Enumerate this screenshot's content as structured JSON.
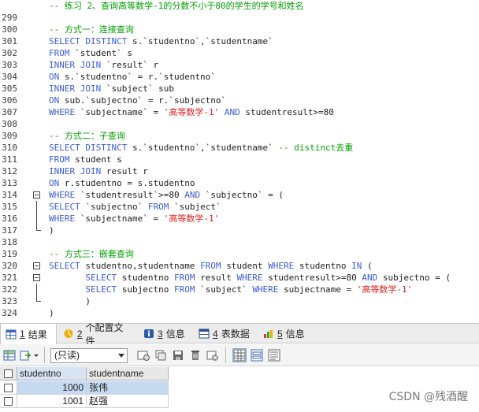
{
  "editor": {
    "lines": [
      {
        "n": "",
        "top": -1,
        "fold": "",
        "parts": [
          [
            "cm",
            "-- 练习 2、查询高等数学-1的分数不小于80的学生的学号和姓名"
          ]
        ]
      },
      {
        "n": "299",
        "fold": "",
        "parts": []
      },
      {
        "n": "300",
        "fold": "",
        "parts": [
          [
            "cm",
            "-- 方式一：连接查询"
          ]
        ]
      },
      {
        "n": "301",
        "fold": "",
        "parts": [
          [
            "kw",
            "SELECT DISTINCT "
          ],
          [
            "tx",
            "s.`studentno`,`studentname`"
          ]
        ]
      },
      {
        "n": "302",
        "fold": "",
        "parts": [
          [
            "kw",
            "FROM "
          ],
          [
            "tx",
            "`student` s"
          ]
        ]
      },
      {
        "n": "303",
        "fold": "",
        "parts": [
          [
            "kw",
            "INNER JOIN "
          ],
          [
            "tx",
            "`result` r"
          ]
        ]
      },
      {
        "n": "304",
        "fold": "",
        "parts": [
          [
            "kw",
            "ON "
          ],
          [
            "tx",
            "s.`studentno` = r.`studentno`"
          ]
        ]
      },
      {
        "n": "305",
        "fold": "",
        "parts": [
          [
            "kw",
            "INNER JOIN "
          ],
          [
            "tx",
            "`subject` sub"
          ]
        ]
      },
      {
        "n": "306",
        "fold": "",
        "parts": [
          [
            "kw",
            "ON "
          ],
          [
            "tx",
            "sub.`subjectno` = r.`subjectno`"
          ]
        ]
      },
      {
        "n": "307",
        "fold": "",
        "parts": [
          [
            "kw",
            "WHERE "
          ],
          [
            "tx",
            "`subjectname` = "
          ],
          [
            "str",
            "'高等数学-1'"
          ],
          [
            "kw",
            " AND "
          ],
          [
            "tx",
            "studentresult>=80"
          ]
        ]
      },
      {
        "n": "308",
        "fold": "",
        "parts": []
      },
      {
        "n": "309",
        "fold": "",
        "parts": [
          [
            "cm",
            "-- 方式二：子查询"
          ]
        ]
      },
      {
        "n": "310",
        "fold": "",
        "parts": [
          [
            "kw",
            "SELECT DISTINCT "
          ],
          [
            "tx",
            "s.`studentno`,`studentname` "
          ],
          [
            "cm",
            "-- distinct去重"
          ]
        ]
      },
      {
        "n": "311",
        "fold": "",
        "parts": [
          [
            "kw",
            "FROM "
          ],
          [
            "tx",
            "student s"
          ]
        ]
      },
      {
        "n": "312",
        "fold": "",
        "parts": [
          [
            "kw",
            "INNER JOIN "
          ],
          [
            "tx",
            "result r"
          ]
        ]
      },
      {
        "n": "313",
        "fold": "",
        "parts": [
          [
            "kw",
            "ON "
          ],
          [
            "tx",
            "r.studentno = s.studentno"
          ]
        ]
      },
      {
        "n": "314",
        "fold": "box",
        "parts": [
          [
            "kw",
            "WHERE "
          ],
          [
            "tx",
            "`studentresult`>=80 "
          ],
          [
            "kw",
            "AND "
          ],
          [
            "tx",
            "`subjectno` = ("
          ]
        ]
      },
      {
        "n": "315",
        "fold": "line",
        "parts": [
          [
            "kw",
            "SELECT "
          ],
          [
            "tx",
            "`subjectno` "
          ],
          [
            "kw",
            "FROM "
          ],
          [
            "tx",
            "`subject`"
          ]
        ]
      },
      {
        "n": "316",
        "fold": "line",
        "parts": [
          [
            "kw",
            "WHERE "
          ],
          [
            "tx",
            "`subjectname` = "
          ],
          [
            "str",
            "'高等数学-1'"
          ]
        ]
      },
      {
        "n": "317",
        "fold": "corner",
        "parts": [
          [
            "tx",
            ")"
          ]
        ]
      },
      {
        "n": "318",
        "fold": "",
        "parts": []
      },
      {
        "n": "319",
        "fold": "",
        "parts": [
          [
            "cm",
            "-- 方式三：嵌套查询"
          ]
        ]
      },
      {
        "n": "320",
        "fold": "box",
        "parts": [
          [
            "kw",
            "SELECT "
          ],
          [
            "tx",
            "studentno,studentname "
          ],
          [
            "kw",
            "FROM "
          ],
          [
            "tx",
            "student "
          ],
          [
            "kw",
            "WHERE "
          ],
          [
            "tx",
            "studentno "
          ],
          [
            "kw",
            "IN "
          ],
          [
            "tx",
            "("
          ]
        ]
      },
      {
        "n": "321",
        "fold": "box",
        "parts": [
          [
            "tx",
            "       "
          ],
          [
            "kw",
            "SELECT "
          ],
          [
            "tx",
            "studentno "
          ],
          [
            "kw",
            "FROM "
          ],
          [
            "tx",
            "result "
          ],
          [
            "kw",
            "WHERE "
          ],
          [
            "tx",
            "studentresult>=80 "
          ],
          [
            "kw",
            "AND "
          ],
          [
            "tx",
            "subjectno = ("
          ]
        ]
      },
      {
        "n": "322",
        "fold": "line",
        "parts": [
          [
            "tx",
            "       "
          ],
          [
            "kw",
            "SELECT "
          ],
          [
            "tx",
            "subjectno "
          ],
          [
            "kw",
            "FROM "
          ],
          [
            "tx",
            "`subject` "
          ],
          [
            "kw",
            "WHERE "
          ],
          [
            "tx",
            "subjectname = "
          ],
          [
            "str",
            "'高等数学-1'"
          ]
        ]
      },
      {
        "n": "323",
        "fold": "corner",
        "parts": [
          [
            "tx",
            "       )"
          ]
        ]
      },
      {
        "n": "324",
        "fold": "",
        "parts": [
          [
            "tx",
            ")"
          ]
        ]
      }
    ]
  },
  "tabs": [
    {
      "num": "1",
      "label": "结果",
      "icon": "table-icon",
      "active": true
    },
    {
      "num": "2",
      "label": "个配置文件",
      "icon": "profile-icon",
      "active": false
    },
    {
      "num": "3",
      "label": "信息",
      "icon": "info-icon",
      "active": false
    },
    {
      "num": "4",
      "label": "表数据",
      "icon": "table-data-icon",
      "active": false
    },
    {
      "num": "5",
      "label": "信息",
      "icon": "chart-info-icon",
      "active": false
    }
  ],
  "toolbar": {
    "mode": "(只读)"
  },
  "grid": {
    "columns": [
      "studentno",
      "studentname"
    ],
    "rows": [
      {
        "studentno": "1000",
        "studentname": "张伟",
        "selected": true
      },
      {
        "studentno": "1001",
        "studentname": "赵强",
        "selected": false
      }
    ]
  },
  "watermark": "CSDN @残酒醒",
  "colors": {
    "keyword": "#3c5cd6",
    "comment": "#00a000",
    "string": "#e02020",
    "selection": "#c5d9f1"
  }
}
